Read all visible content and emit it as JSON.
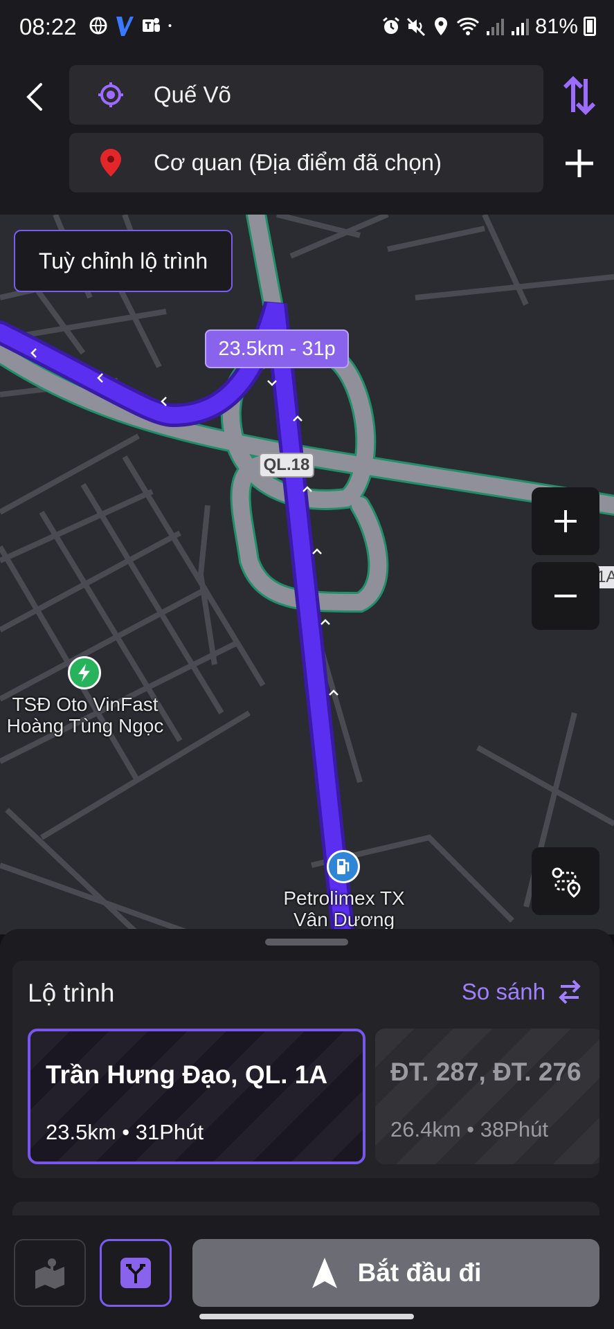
{
  "status_bar": {
    "time": "08:22",
    "battery": "81%",
    "left_icons": [
      "globe-icon",
      "v-app-icon",
      "teams-icon",
      "dot-icon"
    ],
    "right_icons": [
      "alarm-icon",
      "mute-icon",
      "location-icon",
      "wifi-icon",
      "signal-icon",
      "signal-icon",
      "battery-icon"
    ]
  },
  "header": {
    "origin": "Quế Võ",
    "destination": "Cơ quan (Địa điểm đã chọn)",
    "icons": {
      "back": "back-arrow-icon",
      "origin": "location-target-icon",
      "destination": "map-pin-icon",
      "swap": "swap-icon",
      "add": "plus-icon"
    }
  },
  "map": {
    "customize_label": "Tuỳ chỉnh lộ trình",
    "route_callout": "23.5km - 31p",
    "road_shield": "QL.18",
    "edge_label": "1A",
    "pois": [
      {
        "name": "TSĐ Oto VinFast\nHoàng Tùng Ngọc",
        "icon": "ev-charger-icon",
        "color": "#27b35c"
      },
      {
        "name": "Petrolimex TX\nVân Dương",
        "icon": "fuel-pump-icon",
        "color": "#2f86d6"
      }
    ],
    "route_color": "#5a2ff0"
  },
  "routes": {
    "title": "Lộ trình",
    "compare_label": "So sánh",
    "items": [
      {
        "name": "Trần Hưng Đạo, QL. 1A",
        "distance": "23.5km",
        "duration": "31Phút",
        "selected": true
      },
      {
        "name": "ĐT. 287, ĐT. 276",
        "distance": "26.4km",
        "duration": "38Phút",
        "selected": false
      }
    ]
  },
  "bottom_bar": {
    "start_label": "Bắt đầu đi"
  },
  "colors": {
    "accent": "#7b5cf0",
    "background": "#1c1c20",
    "map_bg": "#2b2c31"
  }
}
